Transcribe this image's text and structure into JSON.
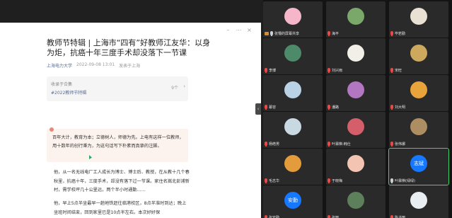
{
  "article": {
    "title": "教师节特辑 | 上海市“四有”好教师江友华：以身为炬，抗癌十年三度手术却没落下一节课",
    "author": "上海电力大学",
    "date": "2022-09-08 13:01",
    "location": "发表于上海",
    "collection_label": "收录于合集",
    "collection_tag": "#2022教师节特辑",
    "collection_count": "9个",
    "quote": "百年大计，教育为本；立德树人，师德为先。上电有这样一位教师，用十数年的创行秉为，为这句话写下朴素而真挚的注脚。",
    "para1": "他，从一名无线电厂工人成长为博士、博士后、教授，在从教十几个春秋里，抗癌十年，三度手术，却没有落下过一节课。家住名嵩北彭浦新村，需学校坪几十公里远，两个半小时通勤……",
    "para2": "他，早上5点半坐最早一趟地铁赶往临港校区，8点半准时到达；晚上坐班时间结束，回到家里已是10点半左右。本次好好保"
  },
  "participants": [
    {
      "name": "张懵的屏幕共享",
      "mic": "on",
      "sharing": true,
      "avatar_color": "#f4b6c8"
    },
    {
      "name": "海平",
      "mic": "off",
      "avatar_color": "#7aa86a"
    },
    {
      "name": "毕若勤",
      "mic": "off",
      "avatar_color": "#e9e1d4"
    },
    {
      "name": "李博",
      "mic": "off",
      "avatar_color": "#4d8a6a"
    },
    {
      "name": "刘兴雨",
      "mic": "off",
      "avatar_color": "#f2efe8"
    },
    {
      "name": "宋旺",
      "mic": "off",
      "avatar_color": "#cda95e"
    },
    {
      "name": "幕容",
      "mic": "off",
      "avatar_color": "#b9d2e6"
    },
    {
      "name": "潘路",
      "mic": "off",
      "avatar_color": "#b377c2"
    },
    {
      "name": "刘大明",
      "mic": "off",
      "avatar_color": "#e8a33a"
    },
    {
      "name": "杨皓男",
      "mic": "off",
      "avatar_color": "#c8d9e2"
    },
    {
      "name": "叶霖棋-韩仕",
      "mic": "off",
      "avatar_color": "#d45f6a"
    },
    {
      "name": "张伟娜",
      "mic": "off",
      "avatar_color": "#ad8e63"
    },
    {
      "name": "毛志华",
      "mic": "off",
      "avatar_color": "#e49b3c"
    },
    {
      "name": "于晓梅",
      "mic": "off",
      "avatar_color": "#f3c4b2"
    },
    {
      "name": "叶霖棋(绿绿)",
      "mic": "on",
      "avatar_text": "志斌",
      "avatar_color": "#1677ff",
      "active": true
    },
    {
      "name": "张安勤",
      "mic": "off",
      "avatar_text": "安勤",
      "avatar_color": "#1677ff"
    },
    {
      "name": "张丽",
      "mic": "off",
      "avatar_color": "#5d7f5b"
    },
    {
      "name": "陈书丽",
      "mic": "off",
      "avatar_color": "#e9eef2"
    }
  ]
}
